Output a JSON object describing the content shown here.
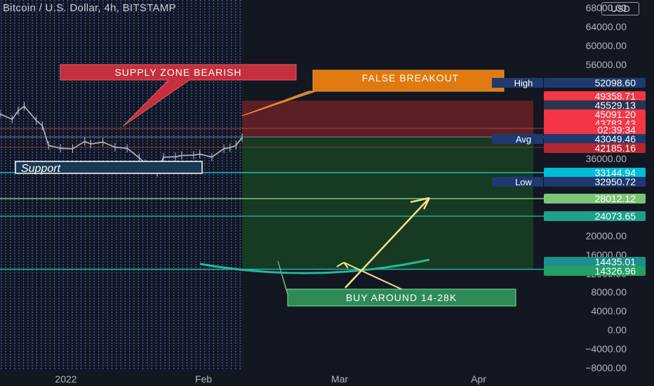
{
  "header": {
    "symbol_title": "Bitcoin / U.S. Dollar, 4h, BITSTAMP",
    "currency_button": "USD"
  },
  "colors": {
    "background": "#131722",
    "grid_dots": "#4a7ff0",
    "red_zone": "#5c1f26",
    "green_zone": "#163a22",
    "cyan_line": "#26c6da",
    "annotation_red": "#c62f3d",
    "annotation_orange": "#e07a10",
    "annotation_green": "#2e8b57",
    "arrow_yellow": "#f5e08a"
  },
  "chart_data": {
    "type": "line",
    "title": "Bitcoin / U.S. Dollar, 4h, BITSTAMP",
    "x_ticks": [
      "2022",
      "Feb",
      "Mar",
      "Apr"
    ],
    "y_ticks": [
      "68000.00",
      "64000.00",
      "60000.00",
      "56000.00",
      "36000.00",
      "20000.00",
      "16000.00",
      "12000.00",
      "8000.00",
      "4000.00",
      "0.00",
      "−4000.00",
      "−8000.00"
    ],
    "price_labels": [
      {
        "text": "52098.60",
        "tag": "High",
        "price": 52098.6,
        "color": "#1e3a6e"
      },
      {
        "text": "49358.71",
        "tag": "",
        "price": 49358.71,
        "color": "#f23645"
      },
      {
        "text": "45529.13",
        "tag": "",
        "price": 45529.13,
        "color": "#2a3550"
      },
      {
        "text": "45091.20",
        "tag": "",
        "price": 45091.2,
        "color": "#f23645"
      },
      {
        "text": "43783.43",
        "tag": "",
        "price": 43783.43,
        "color": "#f23645"
      },
      {
        "text": "02:39:34",
        "tag": "",
        "price": 42600,
        "color": "#f23645"
      },
      {
        "text": "43049.46",
        "tag": "Avg",
        "price": 43049.46,
        "color": "#1e3a6e"
      },
      {
        "text": "42185.16",
        "tag": "",
        "price": 42185.16,
        "color": "#b22833"
      },
      {
        "text": "33144.94",
        "tag": "",
        "price": 33144.94,
        "color": "#00bcd4"
      },
      {
        "text": "32950.72",
        "tag": "Low",
        "price": 32950.72,
        "color": "#1e3a6e"
      },
      {
        "text": "28012.12",
        "tag": "",
        "price": 28012.12,
        "color": "#7cc576"
      },
      {
        "text": "24073.65",
        "tag": "",
        "price": 24073.65,
        "color": "#20a08a"
      },
      {
        "text": "14435.01",
        "tag": "",
        "price": 14435.01,
        "color": "#1d8f8a"
      },
      {
        "text": "14326.96",
        "tag": "",
        "price": 14326.96,
        "color": "#22a066"
      }
    ],
    "price_series": [
      [
        "2021-12-29",
        47300
      ],
      [
        "2021-12-31",
        46500
      ],
      [
        "2022-01-01",
        47800
      ],
      [
        "2022-01-02",
        48500
      ],
      [
        "2022-01-04",
        46300
      ],
      [
        "2022-01-05",
        45500
      ],
      [
        "2022-01-06",
        42500
      ],
      [
        "2022-01-08",
        41700
      ],
      [
        "2022-01-10",
        41400
      ],
      [
        "2022-01-12",
        43100
      ],
      [
        "2022-01-13",
        42700
      ],
      [
        "2022-01-15",
        43000
      ],
      [
        "2022-01-17",
        42200
      ],
      [
        "2022-01-19",
        41700
      ],
      [
        "2022-01-21",
        36500
      ],
      [
        "2022-01-22",
        35000
      ],
      [
        "2022-01-24",
        33200
      ],
      [
        "2022-01-25",
        36800
      ],
      [
        "2022-01-27",
        37000
      ],
      [
        "2022-01-28",
        37700
      ],
      [
        "2022-01-30",
        37900
      ],
      [
        "2022-01-31",
        38500
      ],
      [
        "2022-02-02",
        36800
      ],
      [
        "2022-02-04",
        41500
      ],
      [
        "2022-02-05",
        42000
      ],
      [
        "2022-02-06",
        42500
      ],
      [
        "2022-02-07",
        43700
      ]
    ]
  },
  "annotations": {
    "supply_zone": "SUPPLY ZONE BEARISH",
    "false_breakout": "FALSE BREAKOUT",
    "support": "Support",
    "buy_zone": "BUY AROUND 14-28K"
  }
}
